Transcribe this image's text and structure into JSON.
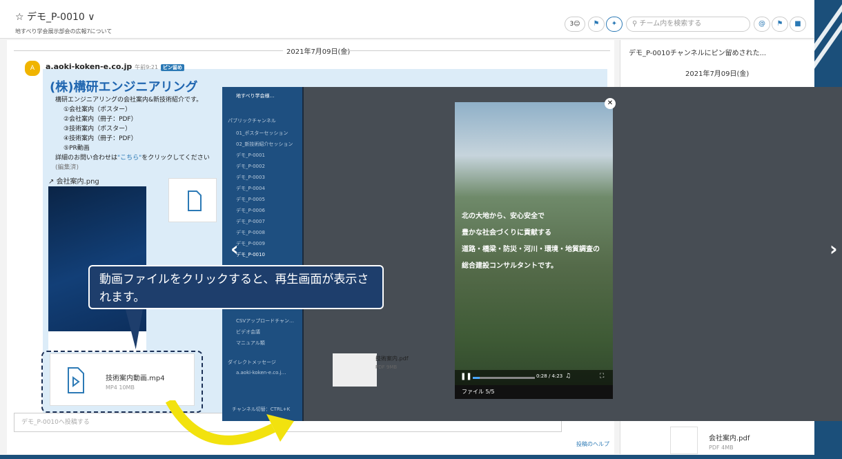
{
  "header": {
    "title": "☆ デモ_P-0010 ∨",
    "subtitle": "地すべり学会展示部会の広報7について",
    "members": "3",
    "search_placeholder": "チーム内を検索する"
  },
  "main": {
    "date": "2021年7月09日(金)",
    "avatar_letter": "A",
    "user": "a.aoki-koken-e.co.jp",
    "time": "午前9:21",
    "pin_label": "ピン留め",
    "company": "(株)構研エンジニアリング",
    "body_lines": [
      "構研エンジニアリングの会社案内&新技術紹介です。",
      "①会社案内（ポスター）",
      "②会社案内（冊子：PDF）",
      "③技術案内（ポスター）",
      "④技術案内（冊子：PDF）",
      "⑤PR動画"
    ],
    "contact_prefix": "詳細のお問い合わせは",
    "contact_link": "\"こちら\"",
    "contact_suffix": "をクリックしてください",
    "edited": "(編集済)",
    "attachment": "会社案内.png",
    "video_name": "技術案内動画.mp4",
    "video_meta": "MP4 10MB",
    "compose_placeholder": "デモ_P-0010へ投稿する"
  },
  "right": {
    "header": "デモ_P-0010チャンネルにピン留めされた...",
    "date": "2021年7月09日(金)",
    "channel": "デモ_P-0010",
    "file_name": "会社案内.pdf",
    "file_meta": "PDF 4MB",
    "help": "投稿のヘルプ"
  },
  "overlay": {
    "team": "地すべり学会様…",
    "public_label": "パブリックチャンネル",
    "channels": [
      "01_ポスターセッション",
      "02_新技術紹介セッション",
      "デモ_P-0001",
      "デモ_P-0002",
      "デモ_P-0003",
      "デモ_P-0004",
      "デモ_P-0005",
      "デモ_P-0006",
      "デモ_P-0007",
      "デモ_P-0008",
      "デモ_P-0009",
      "デモ_P-0010"
    ],
    "extra": [
      "CSVアップロードチャン…",
      "ビデオ会議",
      "マニュアル類"
    ],
    "dm_label": "ダイレクトメッセージ",
    "dm_user": "a.aoki-koken-e.co.j…",
    "switch": "チャンネル切替：CTRL+K",
    "pdf_name": "技術案内.pdf",
    "pdf_meta": "PDF 9MB"
  },
  "video": {
    "lines": [
      "北の大地から、安心安全で",
      "豊かな社会づくりに貢献する",
      "道路・橋梁・防災・河川・環境・地質調査の",
      "総合建設コンサルタントです。"
    ],
    "time": "0:28 / 4:23",
    "footer": "ファイル 5/5",
    "progress": 0.11
  },
  "callout": {
    "text": "動画ファイルをクリックすると、再生画面が表示されます。"
  }
}
